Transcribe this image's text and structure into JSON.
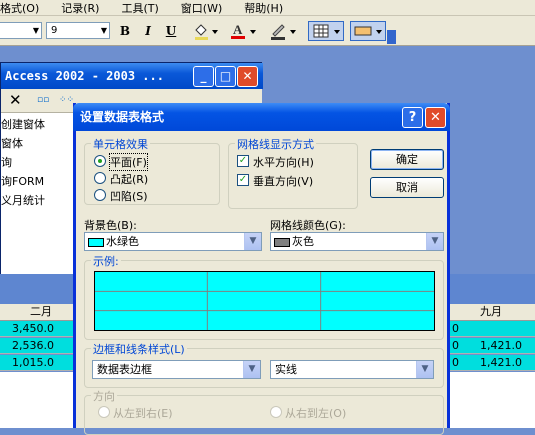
{
  "menu": [
    "格式(O)",
    "记录(R)",
    "工具(T)",
    "窗口(W)",
    "帮助(H)"
  ],
  "toolbar": {
    "font_size": "9",
    "bold": "B",
    "italic": "I",
    "underline": "U"
  },
  "bg_window": {
    "title": "Access 2002 - 2003 ...",
    "items": [
      "创建窗体",
      "窗体",
      "询",
      "询FORM",
      "义月统计"
    ]
  },
  "grid": {
    "headers": [
      "二月",
      "九月"
    ],
    "rows": [
      {
        "col1": "3,450.0",
        "mid": "0",
        "col9": ""
      },
      {
        "col1": "2,536.0",
        "mid": "0",
        "col9": "1,421.0"
      },
      {
        "col1": "1,015.0",
        "mid": "0",
        "col9": "1,421.0"
      }
    ]
  },
  "dialog": {
    "title": "设置数据表格式",
    "cell_effect": {
      "legend": "单元格效果",
      "options": [
        "平面(F)",
        "凸起(R)",
        "凹陷(S)"
      ],
      "selected": 0
    },
    "gridlines": {
      "legend": "网格线显示方式",
      "horizontal": "水平方向(H)",
      "vertical": "垂直方向(V)"
    },
    "ok": "确定",
    "cancel": "取消",
    "bg_color_label": "背景色(B):",
    "bg_color_value": "水绿色",
    "grid_color_label": "网格线颜色(G):",
    "grid_color_value": "灰色",
    "sample_legend": "示例:",
    "border_legend": "边框和线条样式(L)",
    "border_value": "数据表边框",
    "line_value": "实线",
    "direction_legend": "方向",
    "ltr": "从左到右(E)",
    "rtl": "从右到左(O)"
  },
  "colors": {
    "aqua": "#00ffff",
    "gray": "#808080",
    "xp_blue": "#0054e3"
  }
}
